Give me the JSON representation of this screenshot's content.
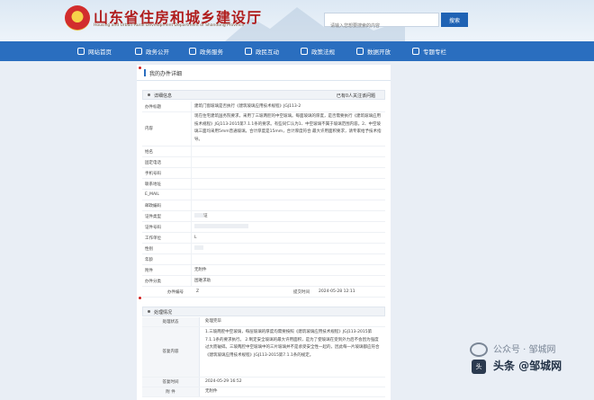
{
  "header": {
    "title": "山东省住房和城乡建设厅",
    "subtitle": "Housing and Urban-Rural Development Department of Shandong Province",
    "search_placeholder": "请输入您想要搜索的内容",
    "search_button": "搜索"
  },
  "nav": [
    {
      "label": "网站首页",
      "icon": "home-icon"
    },
    {
      "label": "政务公开",
      "icon": "document-icon"
    },
    {
      "label": "政务服务",
      "icon": "service-icon"
    },
    {
      "label": "政民互动",
      "icon": "chat-icon"
    },
    {
      "label": "政策法规",
      "icon": "law-icon"
    },
    {
      "label": "数据开放",
      "icon": "data-icon"
    },
    {
      "label": "专题专栏",
      "icon": "topic-icon"
    }
  ],
  "page": {
    "breadcrumb": "我的办件详细",
    "detail_section": "详细信息",
    "detail_status": "已有0人关注该问题",
    "fields": [
      {
        "label": "办件标题",
        "value": "建筑门窗玻璃是否执行《建筑玻璃应用技术规程》JGJ113-2"
      },
      {
        "label": "内容",
        "value": "现在住宅建筑国务院要求，采用了三玻两腔的中空玻璃。每面玻璃的厚度，是否需要执行《建筑玻璃应用技术规程》JGJ113-2015第7.1.1条的要求。有些同仁认为1、中空玻璃不属于玻璃范围内容。2、中空玻璃三面均采用5mm普通玻璃，合计厚度是15mm，合计厚度符合 最大许用面积要求，请专家给予技术指导。"
      },
      {
        "label": "姓名",
        "value": ""
      },
      {
        "label": "固定电话",
        "value": ""
      },
      {
        "label": "手机号码",
        "value": ""
      },
      {
        "label": "联系地址",
        "value": ""
      },
      {
        "label": "E_MAIL",
        "value": ""
      },
      {
        "label": "邮政编码",
        "value": ""
      },
      {
        "label": "证件类型",
        "value": "证"
      },
      {
        "label": "证件号码",
        "value": ""
      },
      {
        "label": "工作单位",
        "value": "L"
      },
      {
        "label": "性别",
        "value": ""
      },
      {
        "label": "年龄",
        "value": ""
      },
      {
        "label": "附件",
        "value": "无附件"
      },
      {
        "label": "办件分类",
        "value": "困难求助"
      }
    ],
    "ticket_label": "办件编号",
    "ticket_value": "Z",
    "submit_label": "提交时间",
    "submit_value": "2024-05-28 12:11",
    "handle_section": "处理情况",
    "handle_rows": [
      {
        "label": "处理状态",
        "value": "处理完毕"
      },
      {
        "label": "答复内容",
        "value": "1.三玻两腔中空玻璃，每层玻璃的厚度均需要按照《建筑玻璃应用技术规程》JGJ113-2015第7.1.1条的要求执行。 2.制定安全玻璃的最大许用面积，是为了使玻璃在受到外力后不会因为强度过大而破碎。三玻两腔中空玻璃中的三片玻璃并不是承受安全性一起的，因此每一片玻璃都应符合《建筑玻璃应用技术规程》JGJ113-2015第7.1.1条的规定。"
      },
      {
        "label": "答复时间",
        "value": "2024-05-29 16:52"
      },
      {
        "label": "附 件",
        "value": "无附件"
      }
    ]
  },
  "watermark": {
    "line1": "公众号 · 邹城网",
    "line2": "头条 @邹城网",
    "badge": "头"
  }
}
